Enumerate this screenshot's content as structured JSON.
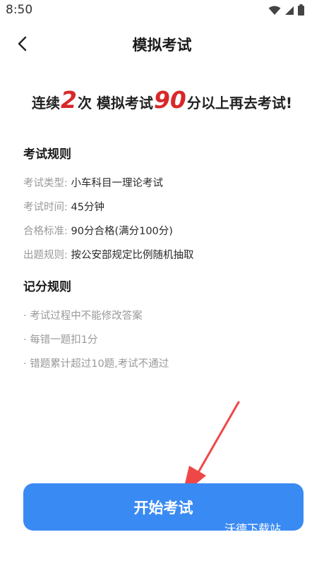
{
  "status_bar": {
    "time": "8:50",
    "icons": [
      "wifi-icon",
      "signal-icon",
      "battery-icon"
    ]
  },
  "header": {
    "title": "模拟考试"
  },
  "headline": {
    "prefix": "连续",
    "count": "2",
    "middle": "次 模拟考试",
    "score": "90",
    "suffix": "分以上再去考试!"
  },
  "exam_rules": {
    "title": "考试规则",
    "items": [
      {
        "label": "考试类型:",
        "value": "小车科目一理论考试"
      },
      {
        "label": "考试时间:",
        "value": "45分钟"
      },
      {
        "label": "合格标准:",
        "value": "90分合格(满分100分)"
      },
      {
        "label": "出题规则:",
        "value": "按公安部规定比例随机抽取"
      }
    ]
  },
  "scoring_rules": {
    "title": "记分规则",
    "items": [
      "· 考试过程中不能修改答案",
      "· 每错一题扣1分",
      "· 错题累计超过10题,考试不通过"
    ]
  },
  "start_button": {
    "label": "开始考试"
  },
  "watermark": {
    "text": "沃德下载站"
  },
  "colors": {
    "accent_blue": "#3a8af3",
    "highlight_red": "#d8282a",
    "arrow_red": "#ef4747"
  }
}
